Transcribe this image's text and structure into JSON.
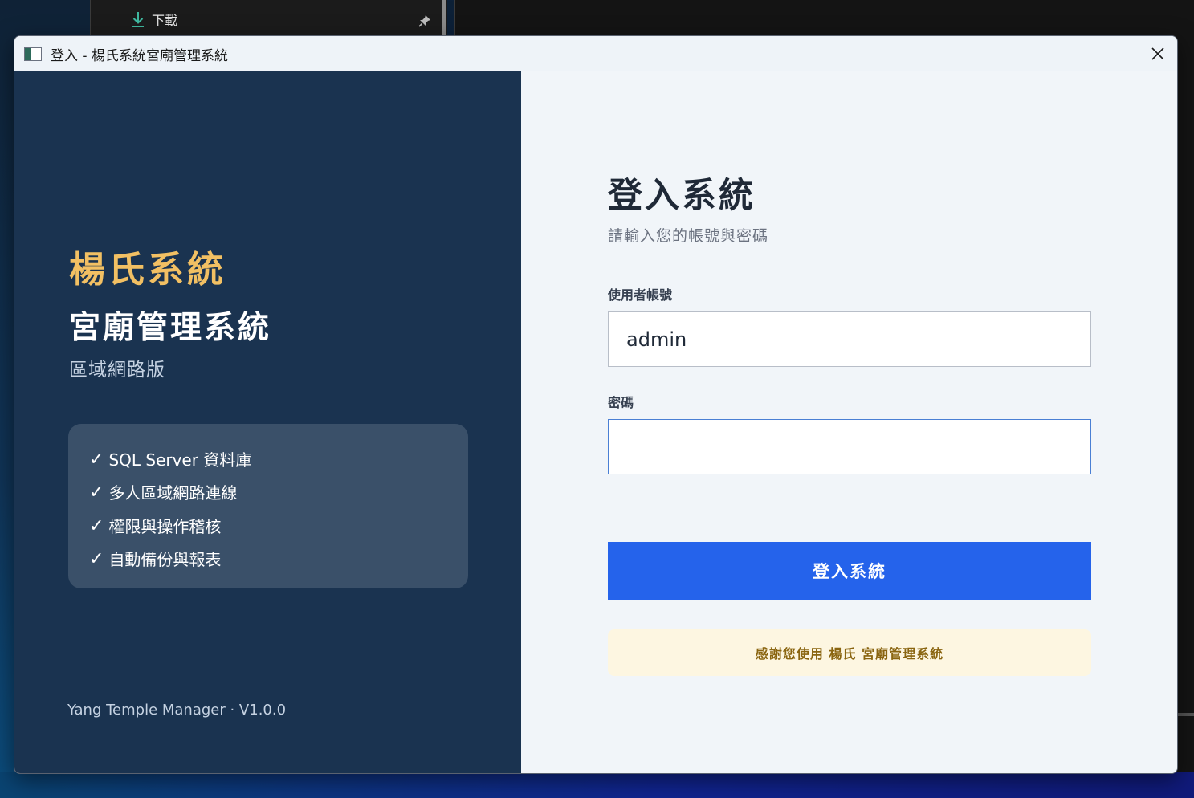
{
  "background": {
    "explorer_item_label": "下載"
  },
  "window": {
    "title": "登入 - 楊氏系統宮廟管理系統"
  },
  "left_panel": {
    "brand_title": "楊氏系統",
    "brand_subtitle": "宮廟管理系統",
    "edition": "區域網路版",
    "features": [
      "SQL Server 資料庫",
      "多人區域網路連線",
      "權限與操作稽核",
      "自動備份與報表"
    ],
    "check_mark": "✓",
    "version": "Yang Temple Manager · V1.0.0"
  },
  "right_panel": {
    "heading": "登入系統",
    "hint": "請輸入您的帳號與密碼",
    "username_label": "使用者帳號",
    "username_value": "admin",
    "password_label": "密碼",
    "password_value": "",
    "login_button": "登入系統",
    "thanks": "感謝您使用 楊氏 宮廟管理系統"
  },
  "colors": {
    "left_panel_bg": "#1a3350",
    "brand_gold": "#f2c063",
    "feature_box_bg": "#3a5069",
    "primary_button": "#2563eb",
    "thanks_bg": "#fdf6e1",
    "thanks_text": "#8a6510"
  }
}
